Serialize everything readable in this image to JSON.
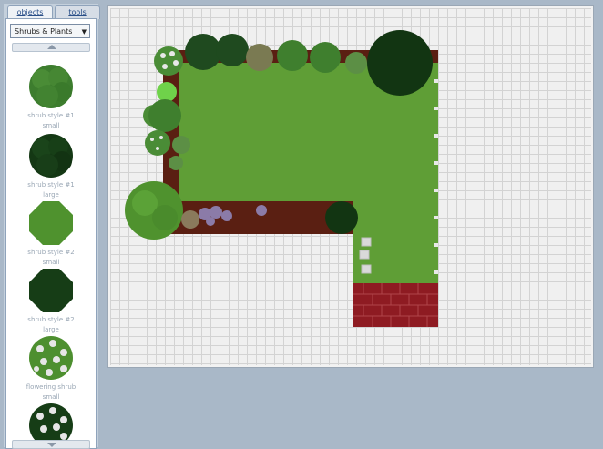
{
  "tabs": [
    {
      "label": "objects"
    },
    {
      "label": "tools"
    }
  ],
  "category_select": {
    "value": "Shrubs & Plants"
  },
  "palette": {
    "items": [
      {
        "label_line1": "shrub style #1",
        "label_line2": "small",
        "icon": "shrub-round-medium-green"
      },
      {
        "label_line1": "shrub style #1",
        "label_line2": "large",
        "icon": "shrub-round-dark-green"
      },
      {
        "label_line1": "shrub style #2",
        "label_line2": "small",
        "icon": "shrub-octagon-green"
      },
      {
        "label_line1": "shrub style #2",
        "label_line2": "large",
        "icon": "shrub-octagon-dark-green"
      },
      {
        "label_line1": "flowering shrub",
        "label_line2": "small",
        "icon": "flowering-shrub-green"
      },
      {
        "label_line1": "",
        "label_line2": "",
        "icon": "flowering-shrub-dark-green"
      }
    ]
  },
  "colors": {
    "lawn": "#5f9e36",
    "mulch": "#5a1f12",
    "brick": "#8e1b22",
    "shrub_dark": "#1f4a1f",
    "shrub_medium": "#3f7f2e",
    "shrub_light": "#6fb244",
    "flower": "#e8e8e8"
  }
}
